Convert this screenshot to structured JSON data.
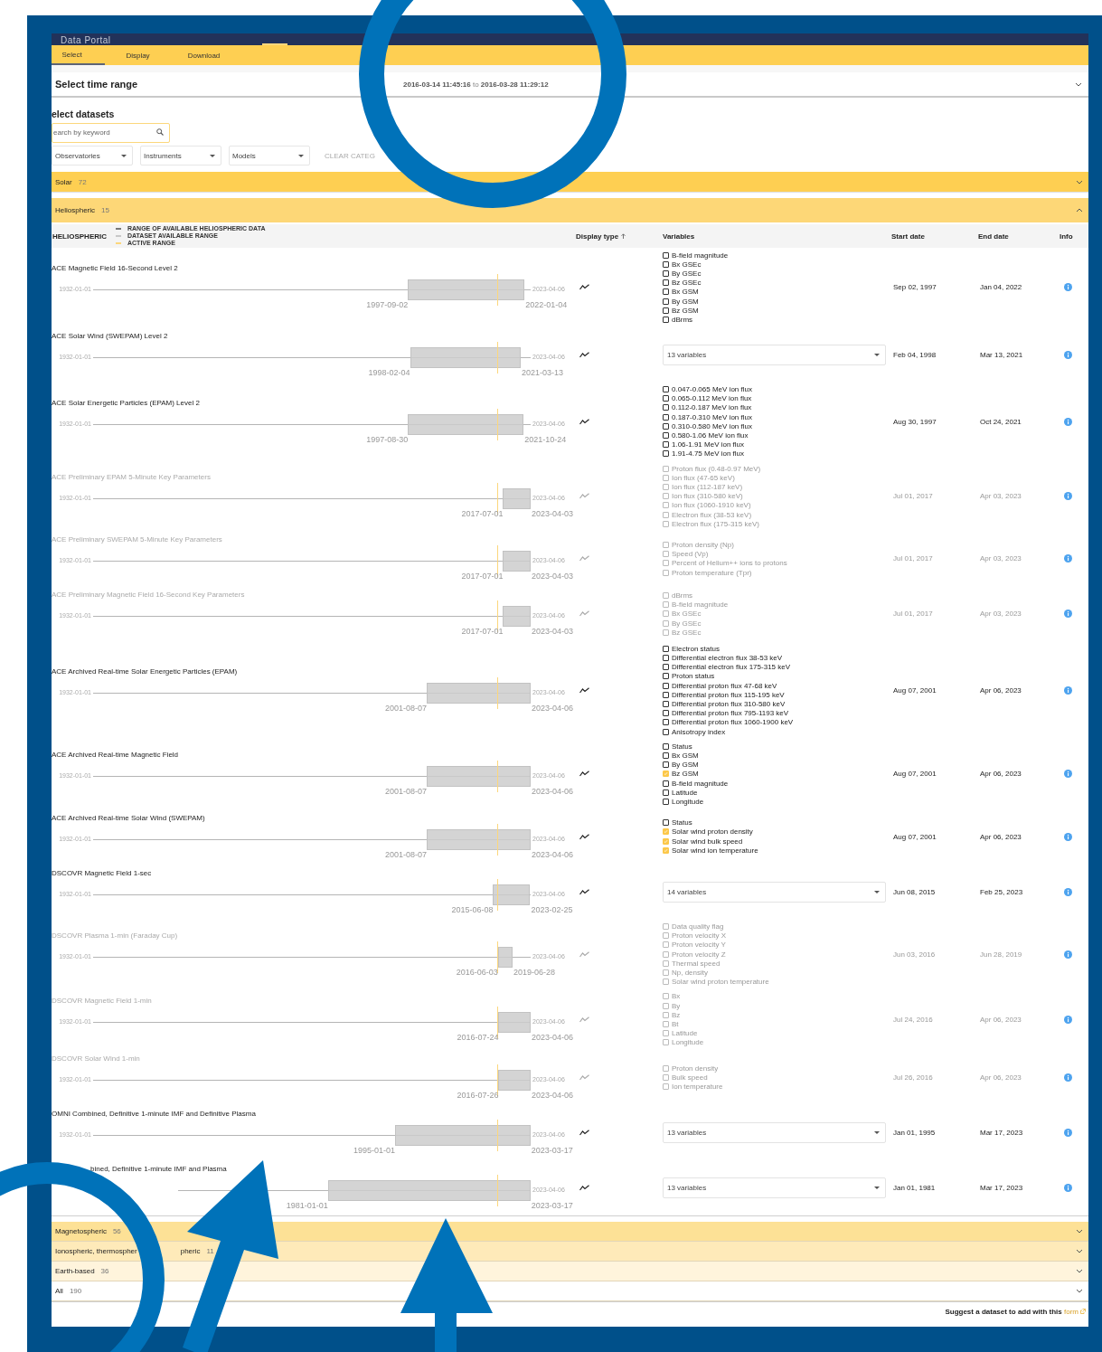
{
  "app": {
    "title": "Data Portal"
  },
  "tabs": [
    {
      "label": "Select",
      "selected": true
    },
    {
      "label": "Display",
      "selected": false
    },
    {
      "label": "Download",
      "selected": false
    }
  ],
  "time_range": {
    "label": "Select time range",
    "start": "2016-03-14 11:45:16",
    "separator": "to",
    "end": "2016-03-28 11:29:12",
    "expanded": false
  },
  "datasets_section": {
    "title": "elect datasets",
    "search": {
      "placeholder": "earch by keyword"
    },
    "filters": [
      "Observatories",
      "Instruments",
      "Models"
    ],
    "clear_button": "CLEAR CATEG"
  },
  "categories_top": [
    {
      "label": "Solar",
      "count": "72",
      "expanded": false,
      "color": "#fecf52"
    },
    {
      "label": "Heliospheric",
      "count": "15",
      "expanded": true,
      "color": "#fdd777"
    }
  ],
  "table": {
    "title": "HELIOSPHERIC",
    "legend": [
      {
        "label": "RANGE OF AVAILABLE HELIOSPHERIC DATA",
        "color": "#777777"
      },
      {
        "label": "DATASET AVAILABLE RANGE",
        "color": "#c8c8c8"
      },
      {
        "label": "ACTIVE RANGE",
        "color": "#fcd77c"
      }
    ],
    "columns": [
      {
        "label": "Display type",
        "sorted": true
      },
      {
        "label": "Variables",
        "sorted": false
      },
      {
        "label": "Start date",
        "sorted": false
      },
      {
        "label": "End date",
        "sorted": false
      },
      {
        "label": "Info",
        "sorted": false
      }
    ],
    "rows": [
      {
        "name": "ACE Magnetic Field 16-Second Level 2",
        "muted": false,
        "obscured": false,
        "timeline": {
          "min": "1932-01-01",
          "max": "2023-04-06",
          "start": "1997-09-02",
          "end": "2022-01-04"
        },
        "variables": {
          "kind": "checklist",
          "items": [
            {
              "label": "B-field magnitude",
              "checked": false
            },
            {
              "label": "Bx GSEc",
              "checked": false
            },
            {
              "label": "By GSEc",
              "checked": false
            },
            {
              "label": "Bz GSEc",
              "checked": false
            },
            {
              "label": "Bx GSM",
              "checked": false
            },
            {
              "label": "By GSM",
              "checked": false
            },
            {
              "label": "Bz GSM",
              "checked": false
            },
            {
              "label": "dBrms",
              "checked": false
            }
          ]
        },
        "start_date": "Sep 02, 1997",
        "end_date": "Jan 04, 2022"
      },
      {
        "name": "ACE Solar Wind (SWEPAM) Level 2",
        "muted": false,
        "obscured": false,
        "timeline": {
          "min": "1932-01-01",
          "max": "2023-04-06",
          "start": "1998-02-04",
          "end": "2021-03-13"
        },
        "variables": {
          "kind": "dropdown",
          "value": "13 variables"
        },
        "start_date": "Feb 04, 1998",
        "end_date": "Mar 13, 2021"
      },
      {
        "name": "ACE Solar Energetic Particles (EPAM) Level 2",
        "muted": false,
        "obscured": false,
        "timeline": {
          "min": "1932-01-01",
          "max": "2023-04-06",
          "start": "1997-08-30",
          "end": "2021-10-24"
        },
        "variables": {
          "kind": "checklist",
          "items": [
            {
              "label": "0.047-0.065 MeV ion flux",
              "checked": false
            },
            {
              "label": "0.065-0.112 MeV ion flux",
              "checked": false
            },
            {
              "label": "0.112-0.187 MeV ion flux",
              "checked": false
            },
            {
              "label": "0.187-0.310 MeV ion flux",
              "checked": false
            },
            {
              "label": "0.310-0.580 MeV ion flux",
              "checked": false
            },
            {
              "label": "0.580-1.06 MeV ion flux",
              "checked": false
            },
            {
              "label": "1.06-1.91 MeV ion flux",
              "checked": false
            },
            {
              "label": "1.91-4.75 MeV ion flux",
              "checked": false
            }
          ]
        },
        "start_date": "Aug 30, 1997",
        "end_date": "Oct 24, 2021"
      },
      {
        "name": "ACE Preliminary EPAM 5-Minute Key Parameters",
        "muted": true,
        "obscured": false,
        "timeline": {
          "min": "1932-01-01",
          "max": "2023-04-06",
          "start": "2017-07-01",
          "end": "2023-04-03"
        },
        "variables": {
          "kind": "checklist",
          "items": [
            {
              "label": "Proton flux (0.48-0.97 MeV)",
              "checked": false
            },
            {
              "label": "Ion flux (47-65 keV)",
              "checked": false
            },
            {
              "label": "Ion flux (112-187 keV)",
              "checked": false
            },
            {
              "label": "Ion flux (310-580 keV)",
              "checked": false
            },
            {
              "label": "Ion flux (1060-1910 keV)",
              "checked": false
            },
            {
              "label": "Electron flux (38-53 keV)",
              "checked": false
            },
            {
              "label": "Electron flux (175-315 keV)",
              "checked": false
            }
          ]
        },
        "start_date": "Jul 01, 2017",
        "end_date": "Apr 03, 2023"
      },
      {
        "name": "ACE Preliminary SWEPAM 5-Minute Key Parameters",
        "muted": true,
        "obscured": false,
        "timeline": {
          "min": "1932-01-01",
          "max": "2023-04-06",
          "start": "2017-07-01",
          "end": "2023-04-03"
        },
        "variables": {
          "kind": "checklist",
          "items": [
            {
              "label": "Proton density (Np)",
              "checked": false
            },
            {
              "label": "Speed (Vp)",
              "checked": false
            },
            {
              "label": "Percent of Helium++ ions to protons",
              "checked": false
            },
            {
              "label": "Proton temperature (Tpr)",
              "checked": false
            }
          ]
        },
        "start_date": "Jul 01, 2017",
        "end_date": "Apr 03, 2023"
      },
      {
        "name": "ACE Preliminary Magnetic Field 16-Second Key Parameters",
        "muted": true,
        "obscured": false,
        "timeline": {
          "min": "1932-01-01",
          "max": "2023-04-06",
          "start": "2017-07-01",
          "end": "2023-04-03"
        },
        "variables": {
          "kind": "checklist",
          "items": [
            {
              "label": "dBrms",
              "checked": false
            },
            {
              "label": "B-field magnitude",
              "checked": false
            },
            {
              "label": "Bx GSEc",
              "checked": false
            },
            {
              "label": "By GSEc",
              "checked": false
            },
            {
              "label": "Bz GSEc",
              "checked": false
            }
          ]
        },
        "start_date": "Jul 01, 2017",
        "end_date": "Apr 03, 2023"
      },
      {
        "name": "ACE Archived Real-time Solar Energetic Particles (EPAM)",
        "muted": false,
        "obscured": false,
        "timeline": {
          "min": "1932-01-01",
          "max": "2023-04-06",
          "start": "2001-08-07",
          "end": "2023-04-06"
        },
        "variables": {
          "kind": "checklist",
          "items": [
            {
              "label": "Electron status",
              "checked": false
            },
            {
              "label": "Differential electron flux 38-53 keV",
              "checked": false
            },
            {
              "label": "Differential electron flux 175-315 keV",
              "checked": false
            },
            {
              "label": "Proton status",
              "checked": false
            },
            {
              "label": "Differential proton flux 47-68 keV",
              "checked": false
            },
            {
              "label": "Differential proton flux 115-195 keV",
              "checked": false
            },
            {
              "label": "Differential proton flux 310-580 keV",
              "checked": false
            },
            {
              "label": "Differential proton flux 795-1193 keV",
              "checked": false
            },
            {
              "label": "Differential proton flux 1060-1900 keV",
              "checked": false
            },
            {
              "label": "Anisotropy index",
              "checked": false
            }
          ]
        },
        "start_date": "Aug 07, 2001",
        "end_date": "Apr 06, 2023"
      },
      {
        "name": "ACE Archived Real-time Magnetic Field",
        "muted": false,
        "obscured": false,
        "timeline": {
          "min": "1932-01-01",
          "max": "2023-04-06",
          "start": "2001-08-07",
          "end": "2023-04-06"
        },
        "variables": {
          "kind": "checklist",
          "items": [
            {
              "label": "Status",
              "checked": false
            },
            {
              "label": "Bx GSM",
              "checked": false
            },
            {
              "label": "By GSM",
              "checked": false
            },
            {
              "label": "Bz GSM",
              "checked": true
            },
            {
              "label": "B-field magnitude",
              "checked": false
            },
            {
              "label": "Latitude",
              "checked": false
            },
            {
              "label": "Longitude",
              "checked": false
            }
          ]
        },
        "start_date": "Aug 07, 2001",
        "end_date": "Apr 06, 2023"
      },
      {
        "name": "ACE Archived Real-time Solar Wind (SWEPAM)",
        "muted": false,
        "obscured": false,
        "timeline": {
          "min": "1932-01-01",
          "max": "2023-04-06",
          "start": "2001-08-07",
          "end": "2023-04-06"
        },
        "variables": {
          "kind": "checklist",
          "items": [
            {
              "label": "Status",
              "checked": false
            },
            {
              "label": "Solar wind proton density",
              "checked": true
            },
            {
              "label": "Solar wind bulk speed",
              "checked": true
            },
            {
              "label": "Solar wind ion temperature",
              "checked": true
            }
          ]
        },
        "start_date": "Aug 07, 2001",
        "end_date": "Apr 06, 2023"
      },
      {
        "name": "DSCOVR Magnetic Field 1-sec",
        "muted": false,
        "obscured": false,
        "timeline": {
          "min": "1932-01-01",
          "max": "2023-04-06",
          "start": "2015-06-08",
          "end": "2023-02-25"
        },
        "variables": {
          "kind": "dropdown",
          "value": "14 variables"
        },
        "start_date": "Jun 08, 2015",
        "end_date": "Feb 25, 2023"
      },
      {
        "name": "DSCOVR Plasma 1-min (Faraday Cup)",
        "muted": true,
        "obscured": false,
        "timeline": {
          "min": "1932-01-01",
          "max": "2023-04-06",
          "start": "2016-06-03",
          "end": "2019-06-28"
        },
        "variables": {
          "kind": "checklist",
          "items": [
            {
              "label": "Data quality flag",
              "checked": false
            },
            {
              "label": "Proton velocity X",
              "checked": false
            },
            {
              "label": "Proton velocity Y",
              "checked": false
            },
            {
              "label": "Proton velocity Z",
              "checked": false
            },
            {
              "label": "Thermal speed",
              "checked": false
            },
            {
              "label": "Np, density",
              "checked": false
            },
            {
              "label": "Solar wind proton temperature",
              "checked": false
            }
          ]
        },
        "start_date": "Jun 03, 2016",
        "end_date": "Jun 28, 2019"
      },
      {
        "name": "DSCOVR Magnetic Field 1-min",
        "muted": true,
        "obscured": false,
        "timeline": {
          "min": "1932-01-01",
          "max": "2023-04-06",
          "start": "2016-07-24",
          "end": "2023-04-06"
        },
        "variables": {
          "kind": "checklist",
          "items": [
            {
              "label": "Bx",
              "checked": false
            },
            {
              "label": "By",
              "checked": false
            },
            {
              "label": "Bz",
              "checked": false
            },
            {
              "label": "Bt",
              "checked": false
            },
            {
              "label": "Latitude",
              "checked": false
            },
            {
              "label": "Longitude",
              "checked": false
            }
          ]
        },
        "start_date": "Jul 24, 2016",
        "end_date": "Apr 06, 2023"
      },
      {
        "name": "DSCOVR Solar Wind 1-min",
        "muted": true,
        "obscured": false,
        "timeline": {
          "min": "1932-01-01",
          "max": "2023-04-06",
          "start": "2016-07-26",
          "end": "2023-04-06"
        },
        "variables": {
          "kind": "checklist",
          "items": [
            {
              "label": "Proton density",
              "checked": false
            },
            {
              "label": "Bulk speed",
              "checked": false
            },
            {
              "label": "Ion temperature",
              "checked": false
            }
          ]
        },
        "start_date": "Jul 26, 2016",
        "end_date": "Apr 06, 2023"
      },
      {
        "name": "OMNI Combined, Definitive 1-minute IMF and Definitive Plasma",
        "muted": false,
        "obscured": false,
        "timeline": {
          "min": "1932-01-01",
          "max": "2023-04-06",
          "start": "1995-01-01",
          "end": "2023-03-17"
        },
        "variables": {
          "kind": "dropdown",
          "value": "13 variables"
        },
        "start_date": "Jan 01, 1995",
        "end_date": "Mar 17, 2023"
      },
      {
        "name": "bined, Definitive 1-minute IMF and Plasma",
        "muted": false,
        "obscured": true,
        "timeline": {
          "max": "2023-04-06",
          "start": "1981-01-01",
          "end": "2023-03-17"
        },
        "variables": {
          "kind": "dropdown",
          "value": "13 variables"
        },
        "start_date": "Jan 01, 1981",
        "end_date": "Mar 17, 2023"
      }
    ]
  },
  "categories_bottom": [
    {
      "label": "Magnetospheric",
      "count": "56",
      "expanded": false,
      "color": "#fde196"
    },
    {
      "label": "Ionospheric, thermospher",
      "label_after": "pheric",
      "count": "11",
      "expanded": false,
      "color": "#feeab9"
    },
    {
      "label": "Earth-based",
      "count": "36",
      "expanded": false,
      "color": "#fff4dc"
    },
    {
      "label": "All",
      "count": "190",
      "expanded": false,
      "color": "#ffffff"
    }
  ],
  "footer": {
    "text": "Suggest a dataset to add with this",
    "link": "form"
  }
}
